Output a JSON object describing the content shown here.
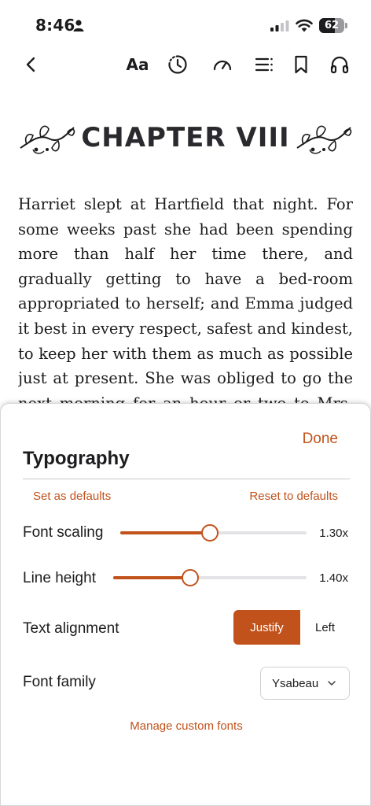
{
  "status_bar": {
    "time": "8:46",
    "battery": "62",
    "battery_level": 0.62,
    "icons": [
      "person-icon",
      "signal-icon",
      "wifi-icon",
      "battery-icon"
    ]
  },
  "toolbar": {
    "font_button_label": "Aa",
    "icons": [
      "back-chevron-icon",
      "history-icon",
      "speed-gauge-icon",
      "toc-list-icon",
      "bookmark-icon",
      "headphones-icon"
    ]
  },
  "reader": {
    "chapter_title": "CHAPTER VIII",
    "paragraph": "Harriet slept at Hartfield that night. For some weeks past she had been spending more than half her time there, and gradually getting to have a bed-room appropriated to herself; and Emma judged it best in every respect, safest and kindest, to keep her with them as much as possible just at present. She was obliged to go the next morning for an hour or two to Mrs. Goddard's, but it"
  },
  "typography": {
    "done_label": "Done",
    "title": "Typography",
    "set_defaults_label": "Set as defaults",
    "reset_defaults_label": "Reset to defaults",
    "font_scaling": {
      "label": "Font scaling",
      "value": "1.30x",
      "fraction": 0.48
    },
    "line_height": {
      "label": "Line height",
      "value": "1.40x",
      "fraction": 0.4
    },
    "text_alignment": {
      "label": "Text alignment",
      "options": [
        "Justify",
        "Left"
      ],
      "selected": "Justify"
    },
    "font_family": {
      "label": "Font family",
      "value": "Ysabeau"
    },
    "manage_fonts_label": "Manage custom fonts"
  },
  "colors": {
    "accent": "#c1521b",
    "text": "#1c1c1e"
  }
}
